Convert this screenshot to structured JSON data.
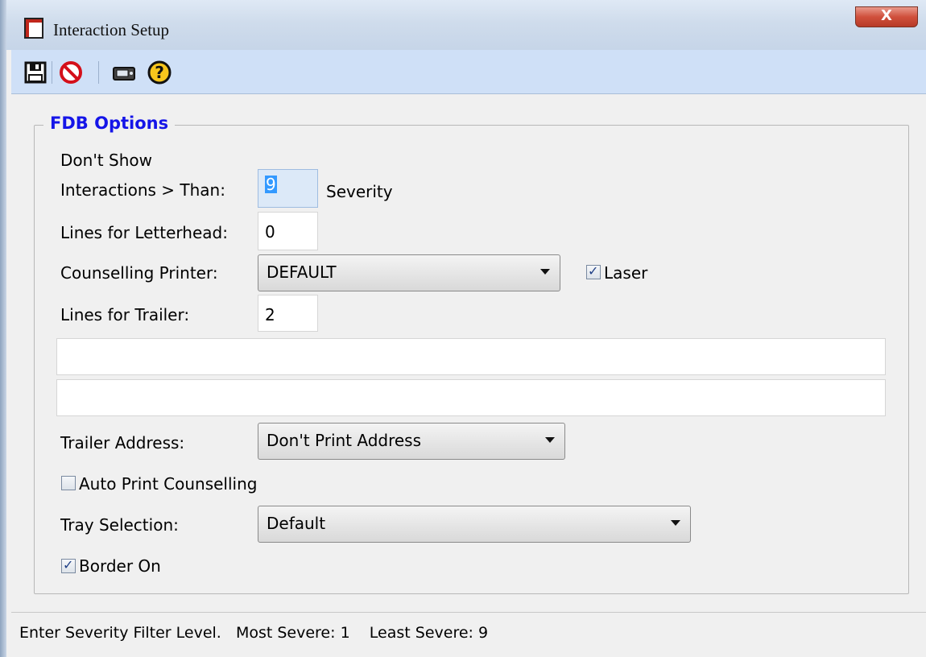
{
  "window": {
    "title": "Interaction Setup",
    "close_label": "X"
  },
  "toolbar": {
    "buttons": [
      {
        "icon": "save-icon"
      },
      {
        "icon": "cancel-icon"
      },
      {
        "icon": "printer-icon"
      },
      {
        "icon": "help-icon"
      }
    ]
  },
  "group": {
    "label": "FDB Options",
    "severity": {
      "label_line1": "Don't Show",
      "label_line2": "Interactions > Than:",
      "value": "9",
      "suffix": "Severity"
    },
    "letterhead": {
      "label": "Lines for Letterhead:",
      "value": "0"
    },
    "counselling_printer": {
      "label": "Counselling Printer:",
      "value": "DEFAULT"
    },
    "laser": {
      "label": "Laser",
      "checked": true
    },
    "trailer": {
      "label": "Lines for Trailer:",
      "value": "2",
      "line1": "",
      "line2": ""
    },
    "trailer_address": {
      "label": "Trailer Address:",
      "value": "Don't Print Address"
    },
    "auto_print": {
      "label": "Auto Print Counselling",
      "checked": false
    },
    "tray": {
      "label": "Tray Selection:",
      "value": "Default"
    },
    "border": {
      "label": "Border On",
      "checked": true
    }
  },
  "status_bar": {
    "text": "Enter Severity Filter Level.   Most Severe: 1    Least Severe: 9"
  }
}
